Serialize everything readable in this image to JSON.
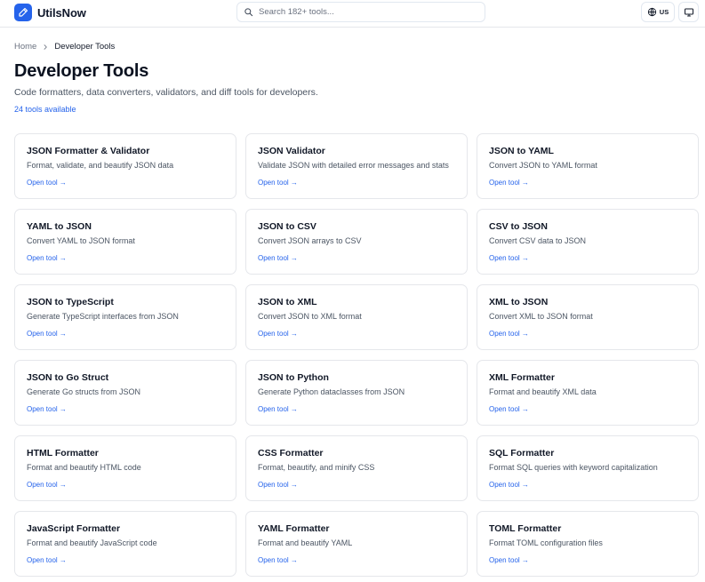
{
  "header": {
    "brand": "UtilsNow",
    "search_placeholder": "Search 182+ tools...",
    "lang_code": "US"
  },
  "breadcrumb": {
    "home": "Home",
    "current": "Developer Tools"
  },
  "page": {
    "title": "Developer Tools",
    "description": "Code formatters, data converters, validators, and diff tools for developers.",
    "count": "24 tools available"
  },
  "tools": [
    {
      "title": "JSON Formatter & Validator",
      "desc": "Format, validate, and beautify JSON data",
      "link": "Open tool →"
    },
    {
      "title": "JSON Validator",
      "desc": "Validate JSON with detailed error messages and stats",
      "link": "Open tool →"
    },
    {
      "title": "JSON to YAML",
      "desc": "Convert JSON to YAML format",
      "link": "Open tool →"
    },
    {
      "title": "YAML to JSON",
      "desc": "Convert YAML to JSON format",
      "link": "Open tool →"
    },
    {
      "title": "JSON to CSV",
      "desc": "Convert JSON arrays to CSV",
      "link": "Open tool →"
    },
    {
      "title": "CSV to JSON",
      "desc": "Convert CSV data to JSON",
      "link": "Open tool →"
    },
    {
      "title": "JSON to TypeScript",
      "desc": "Generate TypeScript interfaces from JSON",
      "link": "Open tool →"
    },
    {
      "title": "JSON to XML",
      "desc": "Convert JSON to XML format",
      "link": "Open tool →"
    },
    {
      "title": "XML to JSON",
      "desc": "Convert XML to JSON format",
      "link": "Open tool →"
    },
    {
      "title": "JSON to Go Struct",
      "desc": "Generate Go structs from JSON",
      "link": "Open tool →"
    },
    {
      "title": "JSON to Python",
      "desc": "Generate Python dataclasses from JSON",
      "link": "Open tool →"
    },
    {
      "title": "XML Formatter",
      "desc": "Format and beautify XML data",
      "link": "Open tool →"
    },
    {
      "title": "HTML Formatter",
      "desc": "Format and beautify HTML code",
      "link": "Open tool →"
    },
    {
      "title": "CSS Formatter",
      "desc": "Format, beautify, and minify CSS",
      "link": "Open tool →"
    },
    {
      "title": "SQL Formatter",
      "desc": "Format SQL queries with keyword capitalization",
      "link": "Open tool →"
    },
    {
      "title": "JavaScript Formatter",
      "desc": "Format and beautify JavaScript code",
      "link": "Open tool →"
    },
    {
      "title": "YAML Formatter",
      "desc": "Format and beautify YAML",
      "link": "Open tool →"
    },
    {
      "title": "TOML Formatter",
      "desc": "Format TOML configuration files",
      "link": "Open tool →"
    }
  ],
  "icons": {
    "logo": "pen-icon",
    "search": "search-icon",
    "language": "globe-icon",
    "display": "monitor-icon",
    "breadcrumb_separator": "chevron-right-icon"
  },
  "colors": {
    "accent": "#2563eb",
    "text": "#0f172a",
    "muted": "#4b5563",
    "border": "#e5e7eb"
  }
}
